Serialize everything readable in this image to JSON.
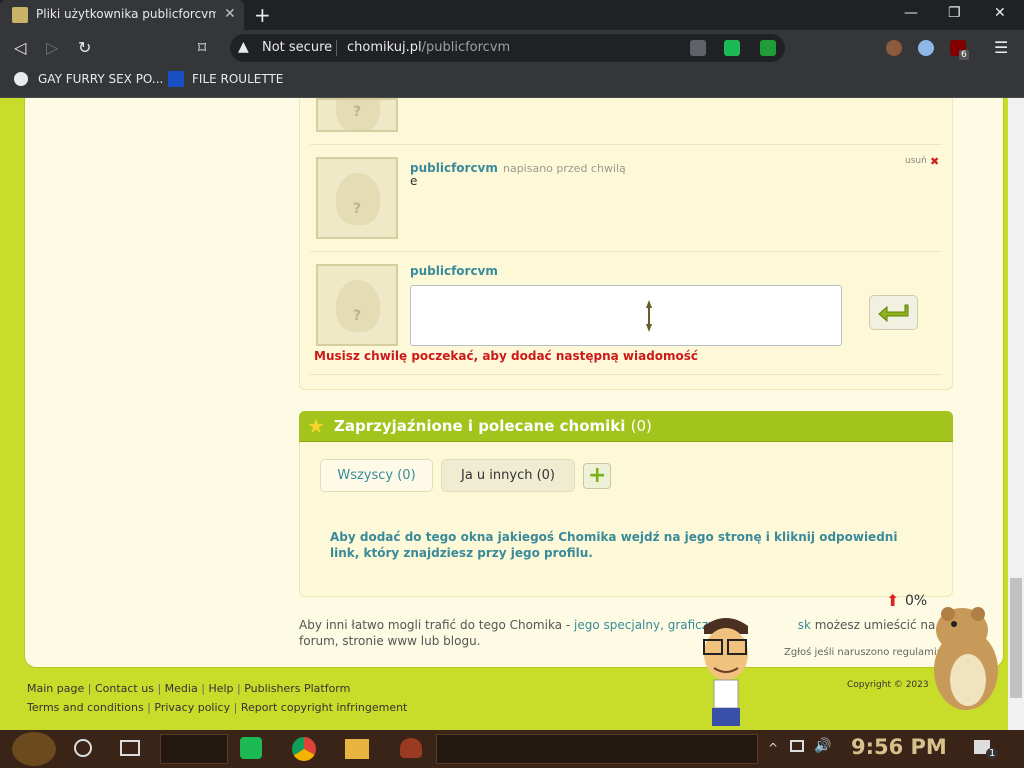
{
  "browser": {
    "tab_title": "Pliki użytkownika publicforcvm - C",
    "address_security": "Not secure",
    "url_domain": "chomikuj.pl",
    "url_path": "/publicforcvm",
    "bookmarks": [
      "GAY FURRY SEX PO...",
      "FILE ROULETTE"
    ],
    "ext_badge": "6"
  },
  "comments": {
    "items": [
      {
        "username": "publicforcvm",
        "meta": "napisano przed chwilą",
        "body": "e",
        "delete_label": "usuń"
      }
    ],
    "new_comment_username": "publicforcvm",
    "error": "Musisz chwilę poczekać, aby dodać następną wiadomość"
  },
  "friends": {
    "title": "Zaprzyjaźnione i polecane chomiki",
    "count": "(0)",
    "tabs": [
      "Wszyscy (0)",
      "Ja u innych (0)"
    ],
    "info": "Aby dodać do tego okna jakiegoś Chomika wejdź na jego stronę i kliknij odpowiedni link, który znajdziesz przy jego profilu."
  },
  "promo": {
    "text_before": "Aby inni łatwo mogli trafić do tego Chomika - ",
    "link": "jego specjalny, graficzn",
    "link_tail": "sk",
    "text_after": " możesz umieścić na forum, stronie www lub blogu.",
    "percent": "0%",
    "report": "Zgłoś jeśli naruszono regulamin"
  },
  "footer": {
    "row1": [
      "Main page",
      "Contact us",
      "Media",
      "Help",
      "Publishers Platform"
    ],
    "row2": [
      "Terms and conditions",
      "Privacy policy",
      "Report copyright infringement"
    ],
    "copyright": "Copyright © 2023"
  },
  "taskbar": {
    "time": "9:56 PM",
    "notifications": "1"
  },
  "colors": {
    "accent_green": "#a3c41c",
    "link_teal": "#3a8a9a",
    "error_red": "#cc1a1a",
    "page_bg": "#c8dc2a"
  }
}
